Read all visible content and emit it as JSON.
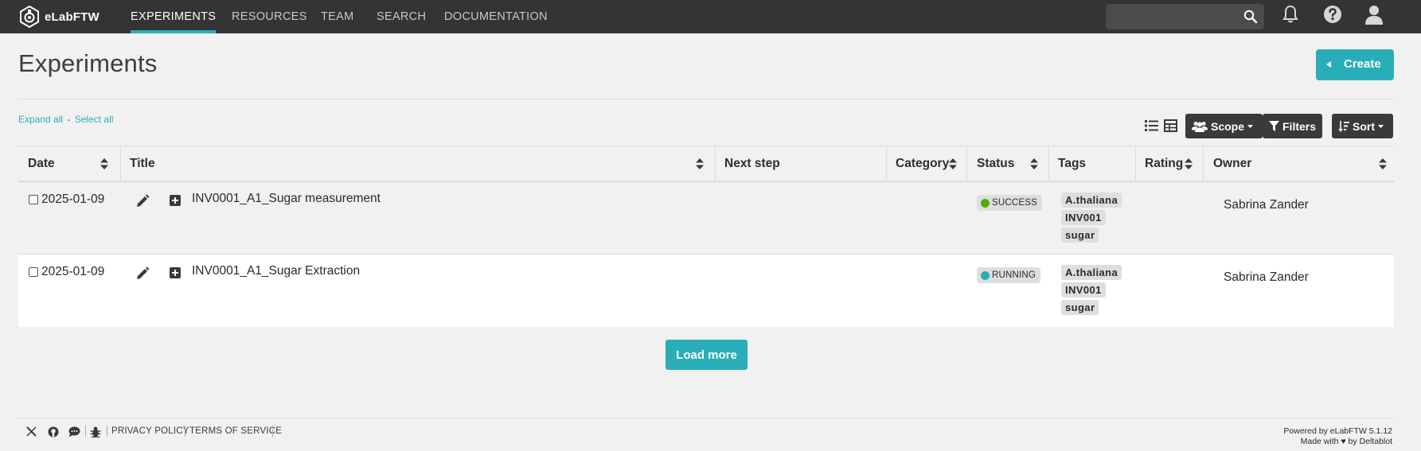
{
  "app": {
    "brand": "eLabFTW",
    "accent": "#29aeb9",
    "navbar_bg": "#343434"
  },
  "nav": {
    "items": [
      "EXPERIMENTS",
      "RESOURCES",
      "TEAM",
      "SEARCH",
      "DOCUMENTATION"
    ],
    "active": "EXPERIMENTS",
    "search_placeholder": "",
    "icons": [
      "search-icon",
      "bell-icon",
      "help-icon",
      "user-icon"
    ]
  },
  "page": {
    "title": "Experiments",
    "create_label": "Create",
    "expand_all": "Expand all",
    "select_all": "Select all",
    "separator": "-",
    "scope_label": "Scope",
    "filters_label": "Filters",
    "sort_label": "Sort",
    "load_more": "Load more"
  },
  "table": {
    "columns": [
      "Date",
      "Title",
      "Next step",
      "Category",
      "Status",
      "Tags",
      "Rating",
      "Owner"
    ],
    "rows": [
      {
        "date": "2025-01-09",
        "title": "INV0001_A1_Sugar measurement",
        "status": "SUCCESS",
        "status_color": "#54aa08",
        "tags": [
          "A.thaliana",
          "INV001",
          "sugar"
        ],
        "owner": "Sabrina Zander",
        "checked": false
      },
      {
        "date": "2025-01-09",
        "title": "INV0001_A1_Sugar Extraction",
        "status": "RUNNING",
        "status_color": "#29aeb9",
        "tags": [
          "A.thaliana",
          "INV001",
          "sugar"
        ],
        "owner": "Sabrina Zander",
        "checked": false
      }
    ]
  },
  "footer": {
    "icons": [
      "x-icon",
      "github-icon",
      "chat-icon",
      "bug-icon"
    ],
    "privacy": "PRIVACY POLICY",
    "terms": "TERMS OF SERVICE",
    "powered": "Powered by eLabFTW 5.1.12",
    "made_with": "Made with ♥ by Deltablot"
  }
}
